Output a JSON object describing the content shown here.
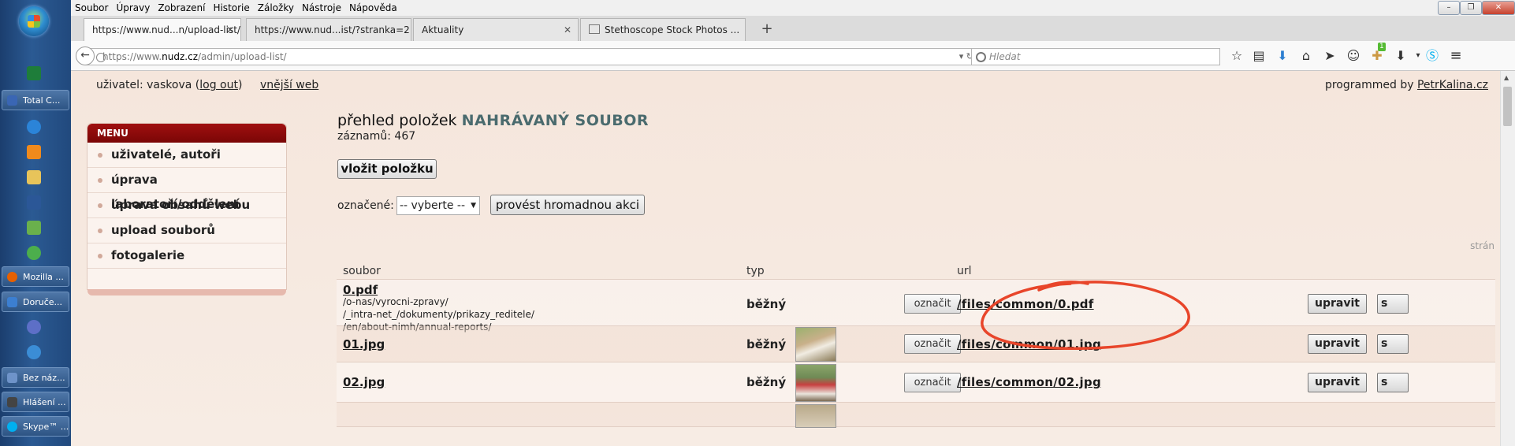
{
  "os": {
    "taskbar_items": [
      {
        "label": "Total C...",
        "icon": "total-commander-icon",
        "color": "#3a66b4"
      },
      {
        "label": "Mozilla ...",
        "icon": "firefox-icon",
        "color": "#e66000"
      },
      {
        "label": "Doruče...",
        "icon": "mail-icon",
        "color": "#3c7fd1"
      },
      {
        "label": "Bez náz...",
        "icon": "notepad-icon",
        "color": "#6e93c9"
      },
      {
        "label": "Hlášení ...",
        "icon": "report-icon",
        "color": "#444"
      },
      {
        "label": "Skype™ ...",
        "icon": "skype-icon",
        "color": "#00aff0"
      }
    ]
  },
  "browser": {
    "menu": [
      "Soubor",
      "Úpravy",
      "Zobrazení",
      "Historie",
      "Záložky",
      "Nástroje",
      "Nápověda"
    ],
    "tabs": [
      {
        "label": "https://www.nud...n/upload-list/"
      },
      {
        "label": "https://www.nud...ist/?stranka=2"
      },
      {
        "label": "Aktuality"
      },
      {
        "label": "Stethoscope Stock Photos ..."
      }
    ],
    "url_prefix": "https://www.",
    "url_domain": "nudz.cz",
    "url_path": "/admin/upload-list/",
    "search_placeholder": "Hledat",
    "addon_badge": "1"
  },
  "page": {
    "user_prefix": "uživatel: vaskova (",
    "logout": "log out",
    "user_suffix": ")",
    "outer_web": "vnější web",
    "credits_prefix": "programmed by ",
    "credits_link": "PetrKalina.cz",
    "menu_title": "MENU",
    "menu_items": [
      "uživatelé, autoři",
      "úprava laboratoří/oddělení",
      "úprava obsahů webu",
      "upload souborů",
      "fotogalerie"
    ],
    "list_title_prefix": "přehled položek ",
    "list_title_strong": "NAHRÁVANÝ SOUBOR",
    "records": "záznamů: 467",
    "insert_button": "vložit položku",
    "marked_label": "označené:",
    "marked_select": "-- vyberte --",
    "bulk_button": "provést hromadnou akci",
    "page_label": "strán",
    "columns": {
      "file": "soubor",
      "type": "typ",
      "url": "url"
    },
    "rows": [
      {
        "name": "0.pdf",
        "paths": [
          "/o-nas/vyrocni-zpravy/",
          "/_intra-net_/dokumenty/prikazy_reditele/",
          "/en/about-nimh/annual-reports/"
        ],
        "type": "běžný",
        "mark": "označit",
        "url": "/files/common/0.pdf",
        "edit": "upravit",
        "extra": "s"
      },
      {
        "name": "01.jpg",
        "paths": [],
        "type": "běžný",
        "mark": "označit",
        "url": "/files/common/01.jpg",
        "edit": "upravit",
        "extra": "s",
        "thumb": "photo-thumb"
      },
      {
        "name": "02.jpg",
        "paths": [],
        "type": "běžný",
        "mark": "označit",
        "url": "/files/common/02.jpg",
        "edit": "upravit",
        "extra": "s",
        "thumb": "photo-thumb"
      }
    ]
  },
  "colors": {
    "menu_header": "#8b0a0a",
    "title_accent": "#4a6b6e",
    "annotation": "#e8452a",
    "page_bg": "#f5e6dc"
  }
}
